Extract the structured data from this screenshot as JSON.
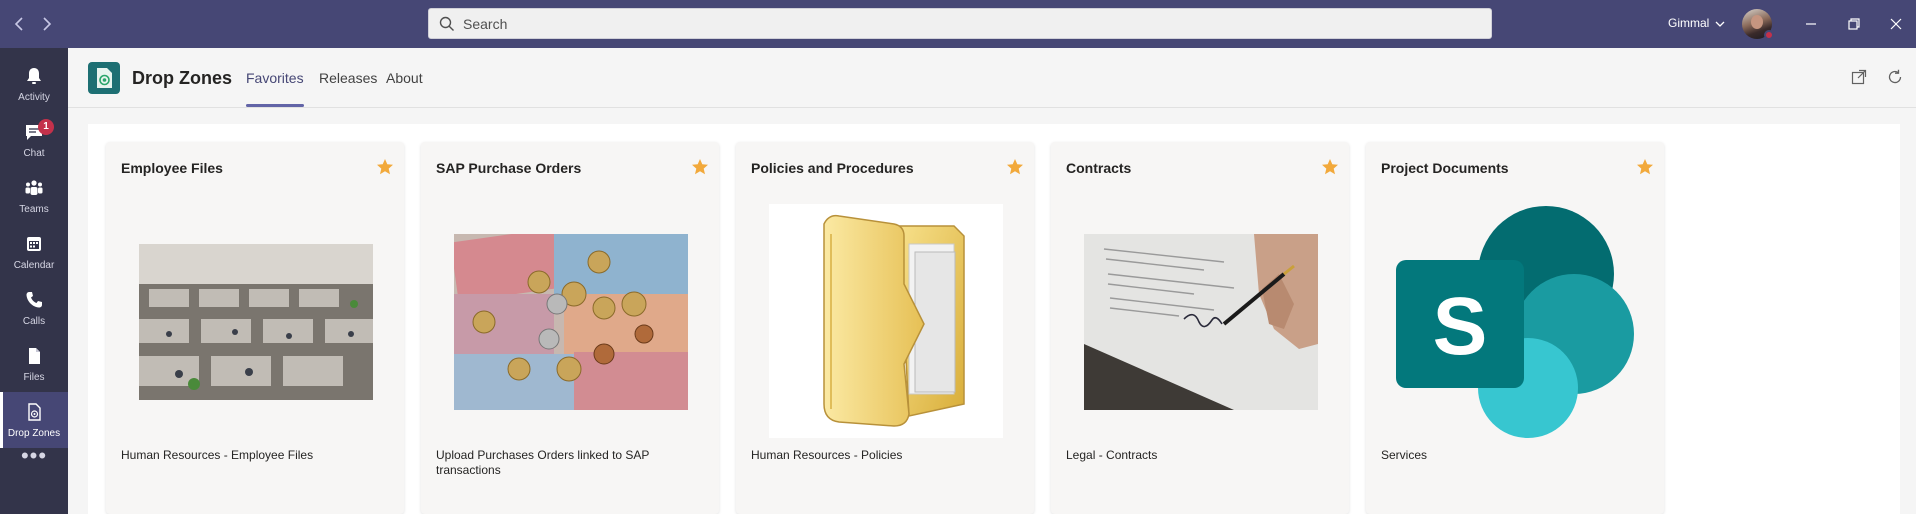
{
  "titlebar": {
    "search_placeholder": "Search",
    "tenant": "Gimmal",
    "back_icon": "chevron-left-icon",
    "forward_icon": "chevron-right-icon",
    "window_buttons": [
      "minimize-icon",
      "restore-icon",
      "close-icon"
    ]
  },
  "rail": {
    "items": [
      {
        "label": "Activity",
        "icon": "bell-icon"
      },
      {
        "label": "Chat",
        "icon": "chat-icon",
        "badge": "1"
      },
      {
        "label": "Teams",
        "icon": "teams-icon"
      },
      {
        "label": "Calendar",
        "icon": "calendar-icon"
      },
      {
        "label": "Calls",
        "icon": "phone-icon"
      },
      {
        "label": "Files",
        "icon": "file-icon"
      },
      {
        "label": "Drop Zones",
        "icon": "drop-zones-icon",
        "active": true
      }
    ],
    "more": "•••"
  },
  "app": {
    "title": "Drop Zones",
    "tabs": [
      {
        "label": "Favorites",
        "active": true
      },
      {
        "label": "Releases"
      },
      {
        "label": "About"
      }
    ]
  },
  "cards": [
    {
      "title": "Employee Files",
      "description": "Human Resources - Employee Files",
      "image": "office-cubicles-photo"
    },
    {
      "title": "SAP Purchase Orders",
      "description": "Upload Purchases Orders linked to SAP transactions",
      "image": "euro-money-photo"
    },
    {
      "title": "Policies and Procedures",
      "description": "Human Resources - Policies",
      "image": "folder-icon"
    },
    {
      "title": "Contracts",
      "description": "Legal - Contracts",
      "image": "signing-contract-photo"
    },
    {
      "title": "Project Documents",
      "description": "Services",
      "image": "sharepoint-logo"
    }
  ],
  "colors": {
    "titlebar": "#464775",
    "rail": "#33344a",
    "accent": "#6264a7",
    "star": "#f2a93b",
    "badge": "#c4314b"
  }
}
